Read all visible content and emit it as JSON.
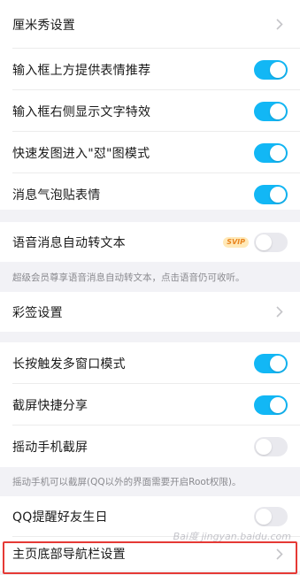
{
  "settings": {
    "row1": {
      "label": "厘米秀设置"
    },
    "row2": {
      "label": "输入框上方提供表情推荐",
      "on": true
    },
    "row3": {
      "label": "输入框右侧显示文字特效",
      "on": true
    },
    "row4": {
      "label": "快速发图进入\"怼\"图模式",
      "on": true
    },
    "row5": {
      "label": "消息气泡贴表情",
      "on": true
    },
    "row6": {
      "label": "语音消息自动转文本",
      "badge": "SVIP",
      "on": false
    },
    "note1": "超级会员尊享语音消息自动转文本，点击语音仍可收听。",
    "row7": {
      "label": "彩签设置"
    },
    "row8": {
      "label": "长按触发多窗口模式",
      "on": true
    },
    "row9": {
      "label": "截屏快捷分享",
      "on": true
    },
    "row10": {
      "label": "摇动手机截屏",
      "on": false
    },
    "note2": "摇动手机可以截屏(QQ以外的界面需要开启Root权限)。",
    "row11": {
      "label": "QQ提醒好友生日",
      "on": false
    },
    "row12": {
      "label": "主页底部导航栏设置"
    }
  },
  "watermark": "Bai度 jingyan.baidu.com",
  "colors": {
    "toggle_on": "#12b7f5",
    "toggle_off": "#e9e9ee",
    "highlight": "#e53935"
  }
}
